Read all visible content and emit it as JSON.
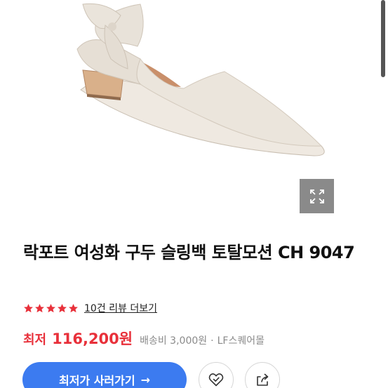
{
  "product": {
    "image_alt": "락포트 여성화 구두 슬링백 토탈모션 CH 9047",
    "title": "락포트 여성화 구두 슬링백 토탈모션 CH 9047",
    "rating": 5,
    "review_link": "10건 리뷰 더보기",
    "price_label": "최저",
    "price": "116,200원",
    "shipping": "배송비 3,000원",
    "separator": "·",
    "store": "LF스퀘어몰"
  },
  "actions": {
    "buy_label": "최저가 사러가기",
    "buy_arrow": "→"
  },
  "colors": {
    "accent": "#3c7bf0",
    "price": "#e8303a",
    "star": "#e8303a"
  },
  "icons": [
    "expand-icon",
    "star-icon",
    "heart-check-icon",
    "share-icon",
    "arrow-right-icon"
  ]
}
